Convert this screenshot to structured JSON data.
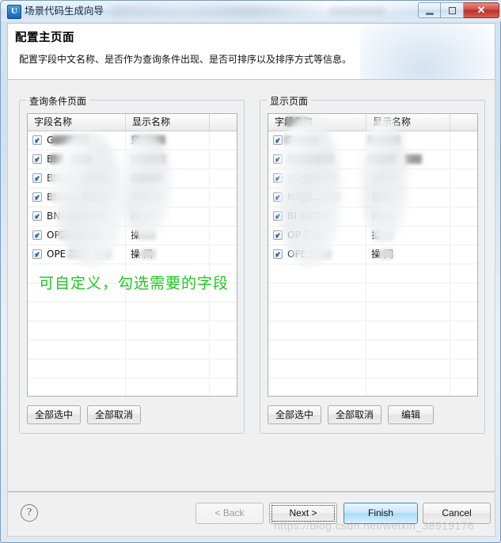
{
  "window": {
    "title": "场景代码生成向导",
    "app_icon": "U",
    "controls": {
      "minimize": "minimize-icon",
      "maximize": "maximize-icon",
      "close": "✕"
    }
  },
  "header": {
    "title": "配置主页面",
    "description": "配置字段中文名称、是否作为查询条件出现、是否可排序以及排序方式等信息。"
  },
  "left_panel": {
    "group_title": "查询条件页面",
    "columns": [
      "字段名称",
      "显示名称",
      ""
    ],
    "rows": [
      {
        "checked": true,
        "field": "G",
        "display": "只"
      },
      {
        "checked": true,
        "field": "BI",
        "display": "编码"
      },
      {
        "checked": true,
        "field": "BI          L...",
        "display": ""
      },
      {
        "checked": true,
        "field": "BI          H...",
        "display": ""
      },
      {
        "checked": true,
        "field": "BN",
        "display": "扌"
      },
      {
        "checked": true,
        "field": "OPE",
        "display": "操"
      },
      {
        "checked": true,
        "field": "OPE      T1",
        "display": "操    间"
      }
    ],
    "annotation": "可自定义，勾选需要的字段",
    "buttons": [
      "全部选中",
      "全部取消"
    ]
  },
  "right_panel": {
    "group_title": "显示页面",
    "columns": [
      "字段名称",
      "显示名称",
      ""
    ],
    "rows": [
      {
        "checked": true,
        "field": "D",
        "display": ""
      },
      {
        "checked": true,
        "field": "ODE",
        "display": "背"
      },
      {
        "checked": true,
        "field": "UE_L...",
        "display": ""
      },
      {
        "checked": true,
        "field": "NE_H...",
        "display": "長"
      },
      {
        "checked": true,
        "field": "BI        RIBE",
        "display": "扌"
      },
      {
        "checked": true,
        "field": "OP       R",
        "display": "操"
      },
      {
        "checked": true,
        "field": "OPE      ME",
        "display": "操    间"
      }
    ],
    "buttons": [
      "全部选中",
      "全部取消",
      "编辑"
    ]
  },
  "footer": {
    "help_icon": "?",
    "back_label": "< Back",
    "back_mnemonic": "B",
    "next_label": "Next >",
    "next_mnemonic": "N",
    "finish_label": "Finish",
    "finish_mnemonic": "F",
    "cancel_label": "Cancel"
  },
  "watermark": "https://blog.csdn.net/weixin_38919176",
  "colors": {
    "accent": "#a9dcf8",
    "annotation_green": "#1ec81e",
    "close_red": "#cf4c42"
  }
}
